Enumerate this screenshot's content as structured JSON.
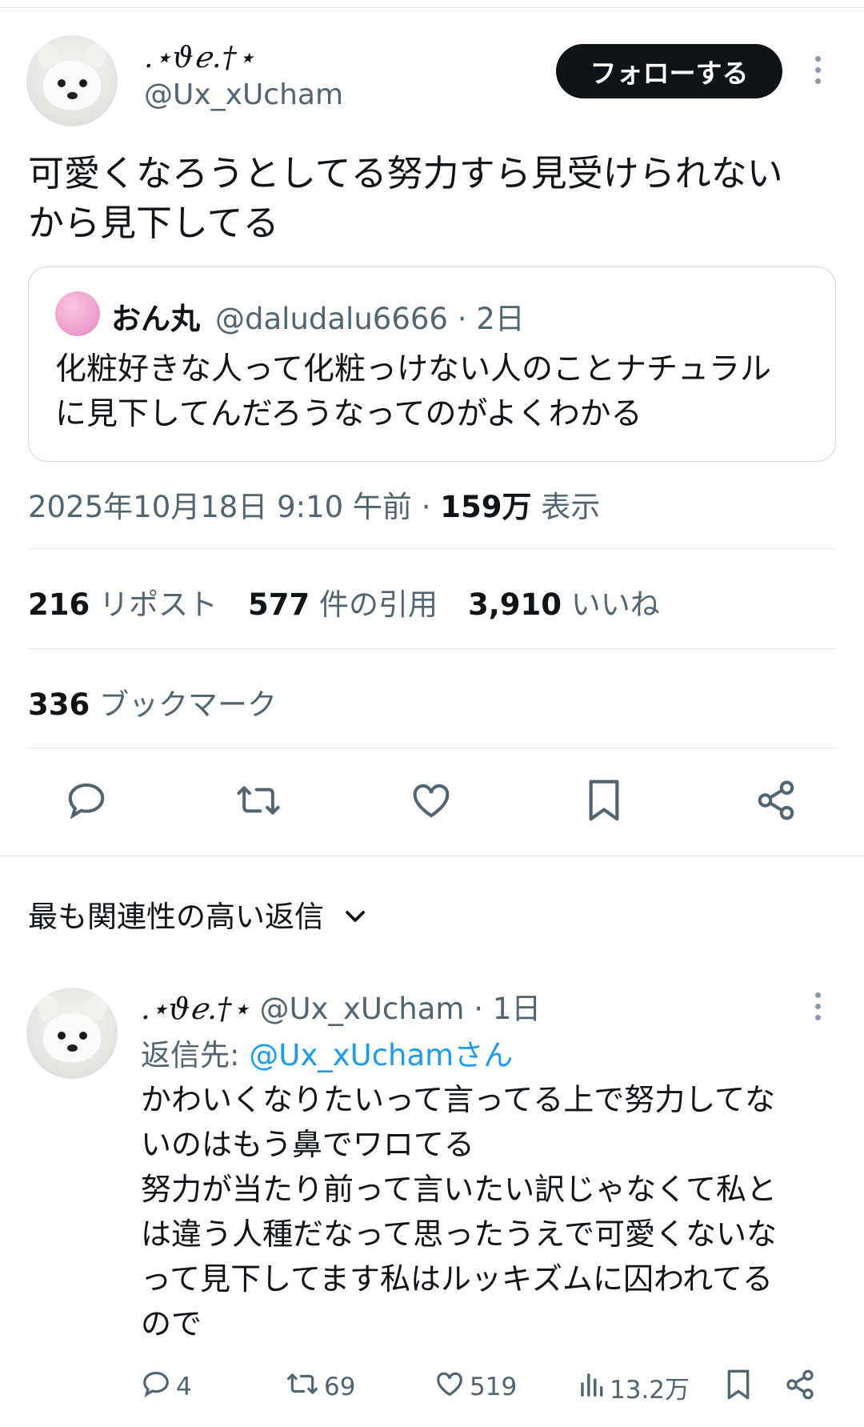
{
  "tweet": {
    "display_name": ".⋆ϑℯ.†⋆",
    "handle": "@Ux_xUcham",
    "follow_label": "フォローする",
    "text": "可愛くなろうとしてる努力すら見受けられない\nから見下してる",
    "timestamp": "2025年10月18日 9:10 午前 · ",
    "views_count": "159万",
    "views_label": " 表示"
  },
  "quote": {
    "name": "おん丸",
    "meta": "@daludalu6666 · 2日",
    "text": "化粧好きな人って化粧っけない人のことナチュラル\nに見下してんだろうなってのがよくわかる"
  },
  "stats": {
    "reposts_count": "216",
    "reposts_label": " リポスト",
    "quotes_count": "577",
    "quotes_label": " 件の引用",
    "likes_count": "3,910",
    "likes_label": " いいね",
    "bookmarks_count": "336",
    "bookmarks_label": " ブックマーク"
  },
  "sort": {
    "label": "最も関連性の高い返信"
  },
  "reply": {
    "display_name": ".⋆ϑℯ.†⋆",
    "meta": " @Ux_xUcham · 1日",
    "reply_to_prefix": "返信先: ",
    "reply_to_mention": "@Ux_xUchamさん",
    "text": "かわいくなりたいって言ってる上で努力してな\nいのはもう鼻でワロてる\n努力が当たり前って言いたい訳じゃなくて私と\nは違う人種だなって思ったうえで可愛くないな\nって見下してます私はルッキズムに囚われてる\nので",
    "replies": "4",
    "reposts": "69",
    "likes": "519",
    "views": "13.2万"
  },
  "colors": {
    "text": "#0f1419",
    "secondary": "#536471",
    "accent": "#1d9bf0",
    "border": "#cfd9de"
  }
}
